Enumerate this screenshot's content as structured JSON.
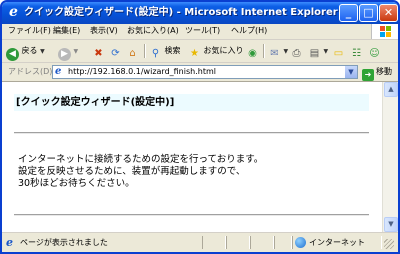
{
  "window": {
    "title": "クイック設定ウィザード(設定中) - Microsoft Internet Explorer",
    "controls": {
      "minimize": "_",
      "maximize": "□",
      "close": "✕"
    }
  },
  "menu": [
    {
      "label": "ファイル(F)"
    },
    {
      "label": "編集(E)"
    },
    {
      "label": "表示(V)"
    },
    {
      "label": "お気に入り(A)"
    },
    {
      "label": "ツール(T)"
    },
    {
      "label": "ヘルプ(H)"
    }
  ],
  "toolbar": {
    "back_label": "戻る",
    "search_label": "検索",
    "favorites_label": "お気に入り"
  },
  "address": {
    "label": "アドレス(D)",
    "url": "http://192.168.0.1/wizard_finish.html",
    "go_label": "移動"
  },
  "content": {
    "heading": "[クイック設定ウィザード(設定中)]",
    "message_lines": [
      "インターネットに接続するための設定を行っております。",
      "設定を反映させるために、装置が再起動しますので、",
      "30秒ほどお待ちください。"
    ]
  },
  "status": {
    "text": "ページが表示されました",
    "zone": "インターネット"
  },
  "colors": {
    "titlebar": "#0651d6",
    "heading_bg": "#ecfbff",
    "chrome": "#ece9d8"
  }
}
